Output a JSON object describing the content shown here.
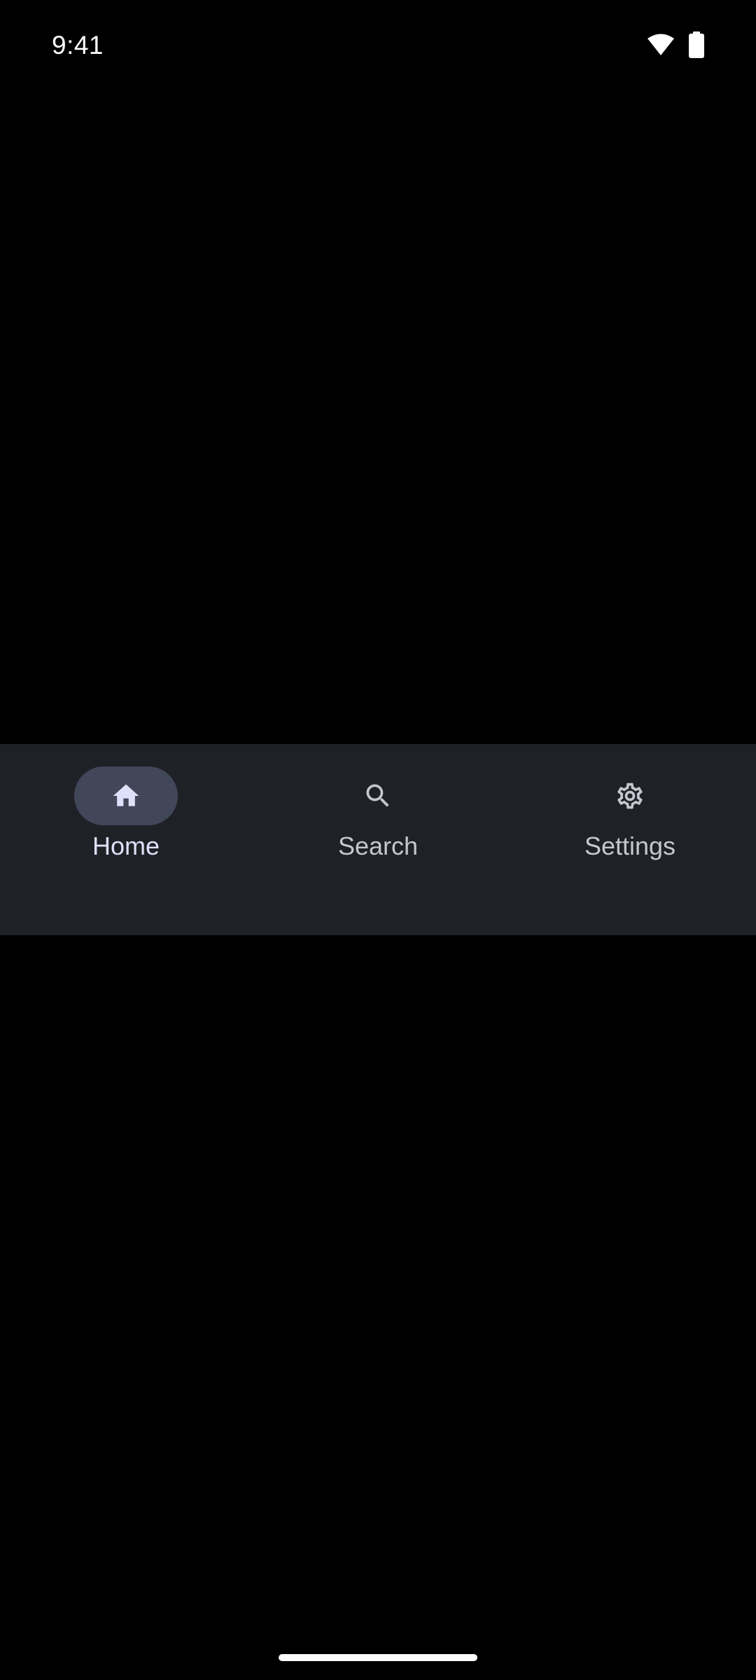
{
  "status_bar": {
    "time": "9:41",
    "icons": [
      "wifi-icon",
      "battery-icon"
    ]
  },
  "navigation": {
    "selected": "Home",
    "items": [
      {
        "label": "Home",
        "icon": "home-icon",
        "active": true
      },
      {
        "label": "Search",
        "icon": "search-icon",
        "active": false
      },
      {
        "label": "Settings",
        "icon": "gear-icon",
        "active": false
      }
    ]
  },
  "colors": {
    "background": "#000000",
    "nav_surface": "#202127",
    "active_indicator": "#414659",
    "active_content": "#dde1f9",
    "inactive_content": "#c6c6d0",
    "status_text": "#ffffff"
  }
}
